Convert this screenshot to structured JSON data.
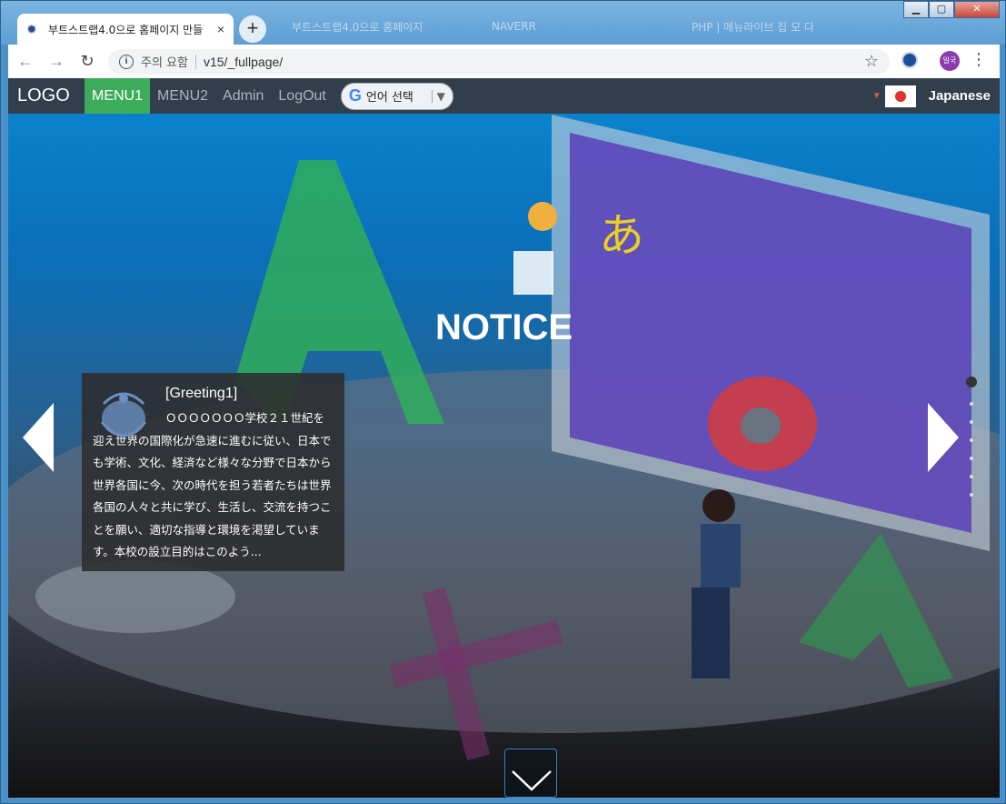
{
  "browser": {
    "tab_title": "부트스트랩4.0으로 홈페이지 만들",
    "tab_close": "×",
    "new_tab": "+",
    "ghost_tabs": [
      "부트스트랩4.0으로 홈페이지",
      "NAVERR",
      "PHP | 메뉴라이브 집 모 다"
    ],
    "security_warning": "주의 요함",
    "url": "v15/_fullpage/",
    "profile_text": "일국"
  },
  "nav": {
    "logo": "LOGO",
    "menus": [
      "MENU1",
      "MENU2",
      "Admin",
      "LogOut"
    ],
    "translate_label": "언어 선택",
    "language": "Japanese"
  },
  "hero": {
    "title": "NOTICE",
    "card_title": "[Greeting1]",
    "card_body": "ＯＯＯＯＯＯＯ学校２１世紀を迎え世界の国際化が急速に進むに従い、日本でも学術、文化、経済など様々な分野で日本から世界各国に今、次の時代を担う若者たちは世界各国の人々と共に学び、生活し、交流を持つことを願い、適切な指導と環境を渇望しています。本校の設立目的はこのよう..."
  },
  "colors": {
    "nav_bg": "#303f4b",
    "active_menu": "#3cac5b"
  },
  "icons": [
    "info-icon",
    "star-icon",
    "back-icon",
    "forward-icon",
    "reload-icon",
    "prev-arrow-icon",
    "next-arrow-icon",
    "chevron-down-icon"
  ]
}
